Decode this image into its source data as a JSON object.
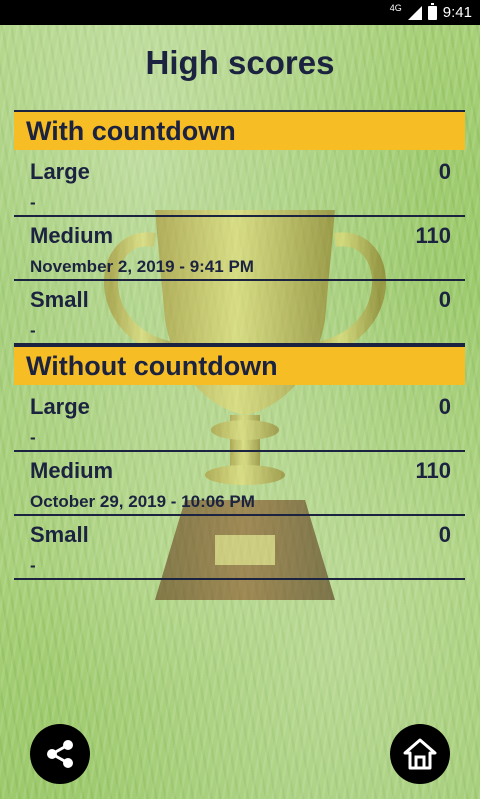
{
  "status_bar": {
    "network": "4G",
    "time": "9:41"
  },
  "title": "High scores",
  "sections": [
    {
      "header": "With countdown",
      "rows": [
        {
          "label": "Large",
          "score": "0",
          "date": "-"
        },
        {
          "label": "Medium",
          "score": "110",
          "date": "November 2, 2019  -  9:41 PM"
        },
        {
          "label": "Small",
          "score": "0",
          "date": "-"
        }
      ]
    },
    {
      "header": "Without countdown",
      "rows": [
        {
          "label": "Large",
          "score": "0",
          "date": "-"
        },
        {
          "label": "Medium",
          "score": "110",
          "date": "October 29, 2019  -  10:06 PM"
        },
        {
          "label": "Small",
          "score": "0",
          "date": "-"
        }
      ]
    }
  ],
  "buttons": {
    "share_icon": "share-icon",
    "home_icon": "home-icon"
  }
}
